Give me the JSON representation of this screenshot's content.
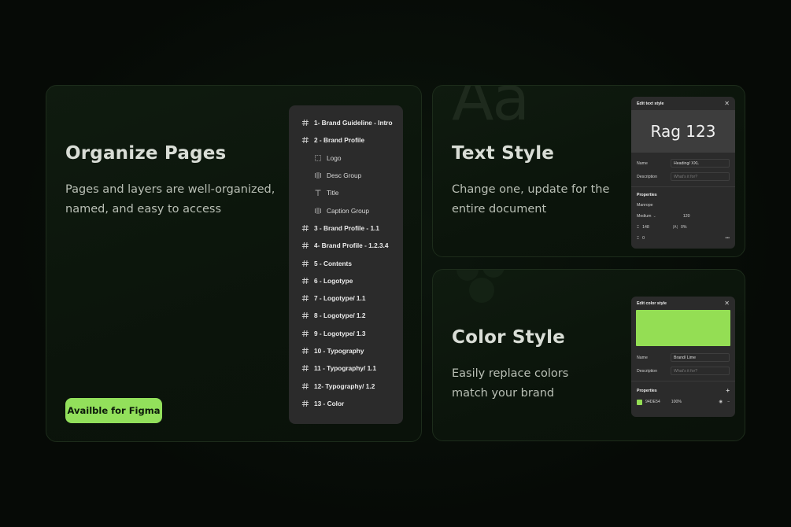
{
  "pages_card": {
    "title": "Organize Pages",
    "description_line1": "Pages and layers are well-organized,",
    "description_line2": "named, and easy to access",
    "button_label": "Availble  for Figma",
    "layers": [
      {
        "label": "1- Brand Guideline - Intro",
        "kind": "page",
        "icon": "hash-icon"
      },
      {
        "label": "2 - Brand Profile",
        "kind": "page",
        "icon": "hash-icon"
      },
      {
        "label": "Logo",
        "kind": "child",
        "icon": "dotted-frame-icon"
      },
      {
        "label": "Desc Group",
        "kind": "child",
        "icon": "group-icon"
      },
      {
        "label": "Title",
        "kind": "child",
        "icon": "text-icon"
      },
      {
        "label": "Caption Group",
        "kind": "child",
        "icon": "group-icon"
      },
      {
        "label": "3 - Brand Profile - 1.1",
        "kind": "page",
        "icon": "hash-icon"
      },
      {
        "label": "4- Brand Profile - 1.2.3.4",
        "kind": "page",
        "icon": "hash-icon"
      },
      {
        "label": "5 - Contents",
        "kind": "page",
        "icon": "hash-icon"
      },
      {
        "label": "6 - Logotype",
        "kind": "page",
        "icon": "hash-icon"
      },
      {
        "label": "7 - Logotype/ 1.1",
        "kind": "page",
        "icon": "hash-icon"
      },
      {
        "label": "8 - Logotype/ 1.2",
        "kind": "page",
        "icon": "hash-icon"
      },
      {
        "label": "9 - Logotype/ 1.3",
        "kind": "page",
        "icon": "hash-icon"
      },
      {
        "label": "10 - Typography",
        "kind": "page",
        "icon": "hash-icon"
      },
      {
        "label": "11 - Typography/ 1.1",
        "kind": "page",
        "icon": "hash-icon"
      },
      {
        "label": "12- Typography/ 1.2",
        "kind": "page",
        "icon": "hash-icon"
      },
      {
        "label": "13 - Color",
        "kind": "page",
        "icon": "hash-icon"
      }
    ]
  },
  "text_card": {
    "title": "Text Style",
    "description_line1": "Change one, update for the",
    "description_line2": "entire document",
    "deco_letters": "Aa",
    "panel": {
      "title": "Edit text style",
      "preview": "Rag 123",
      "name_label": "Name",
      "name_value": "Heading/ XXL",
      "description_label": "Description",
      "description_placeholder": "What's it for?",
      "properties_label": "Properties",
      "font": "Manrope",
      "weight": "Medium",
      "size": "120",
      "line_height": "148",
      "letter_spacing_label": "|A|",
      "letter_spacing": "0%",
      "paragraph_spacing": "0",
      "more": "•••"
    }
  },
  "color_card": {
    "title": "Color Style",
    "description_line1": "Easily replace colors",
    "description_line2": "match your brand",
    "panel": {
      "title": "Edit color style",
      "name_label": "Name",
      "name_value": "Brand/ Lime",
      "description_label": "Description",
      "description_placeholder": "What's it for?",
      "properties_label": "Properties",
      "hex": "94DE54",
      "opacity": "100%",
      "swatch_color": "#94DE54"
    }
  },
  "colors": {
    "accent": "#92E05B",
    "background": "#060B07",
    "panel": "#2B2B2B"
  }
}
